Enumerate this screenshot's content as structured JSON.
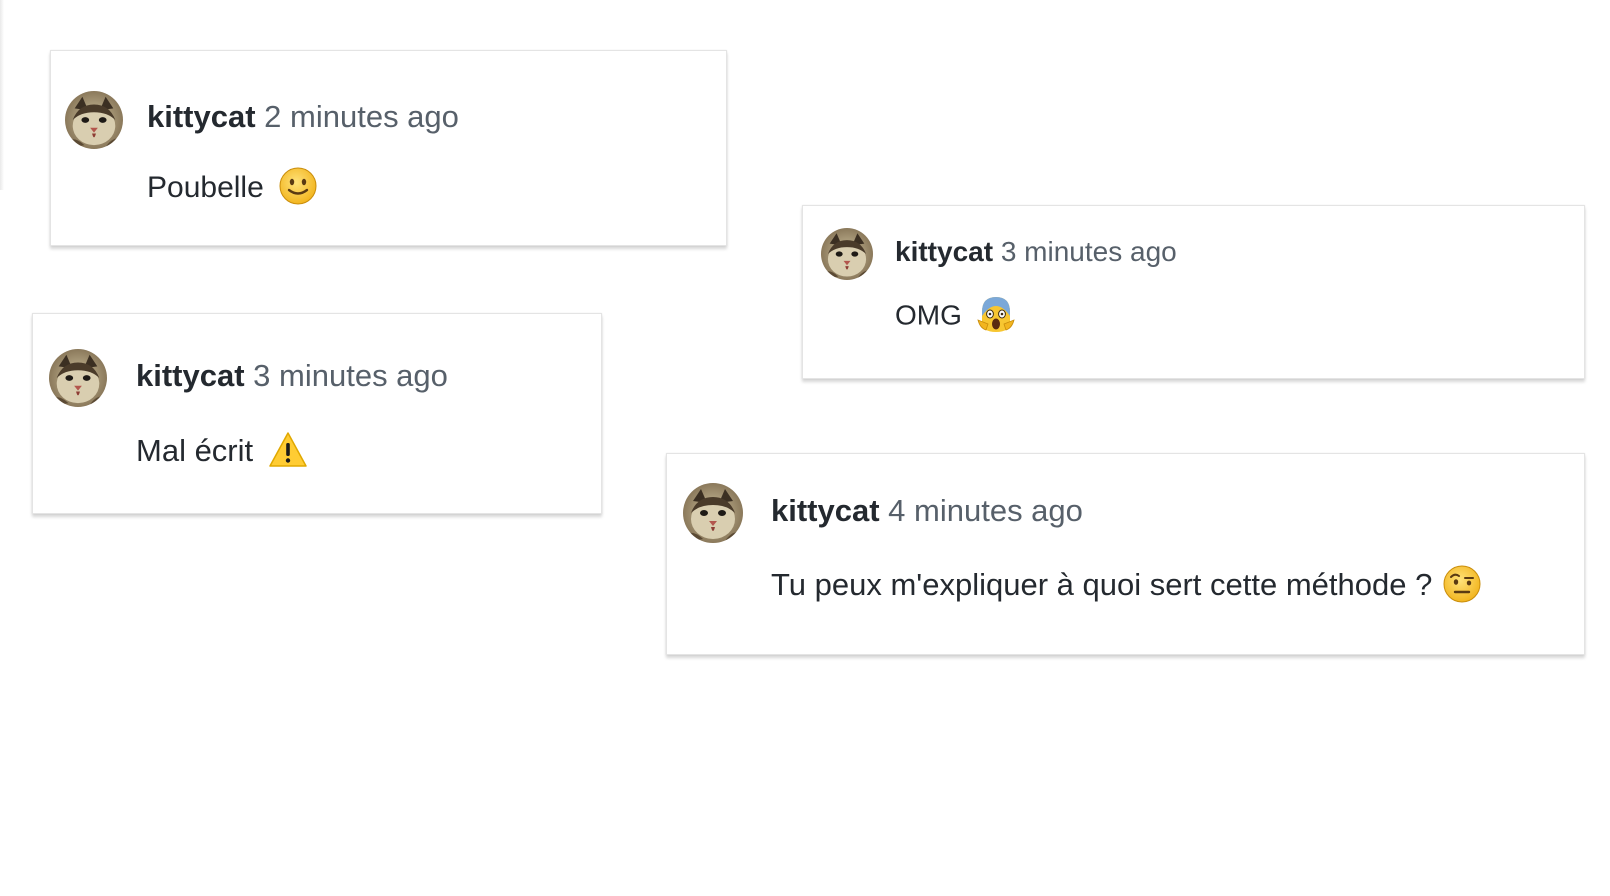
{
  "comments": [
    {
      "author": "kittycat",
      "time": "2 minutes ago",
      "text": "Poubelle",
      "emoji": "slightly-smiling-face-icon"
    },
    {
      "author": "kittycat",
      "time": "3 minutes ago",
      "text": "OMG",
      "emoji": "face-screaming-in-fear-icon"
    },
    {
      "author": "kittycat",
      "time": "3 minutes ago",
      "text": "Mal écrit",
      "emoji": "warning-icon"
    },
    {
      "author": "kittycat",
      "time": "4 minutes ago",
      "text": "Tu peux m'expliquer à quoi sert cette méthode ?",
      "emoji": "face-with-raised-eyebrow-icon"
    }
  ],
  "colors": {
    "author_text": "#24292f",
    "timestamp_text": "#57606a",
    "card_border": "#e4e4e4",
    "emoji_yellow": "#f7c631",
    "warning_yellow": "#ffcc33"
  }
}
